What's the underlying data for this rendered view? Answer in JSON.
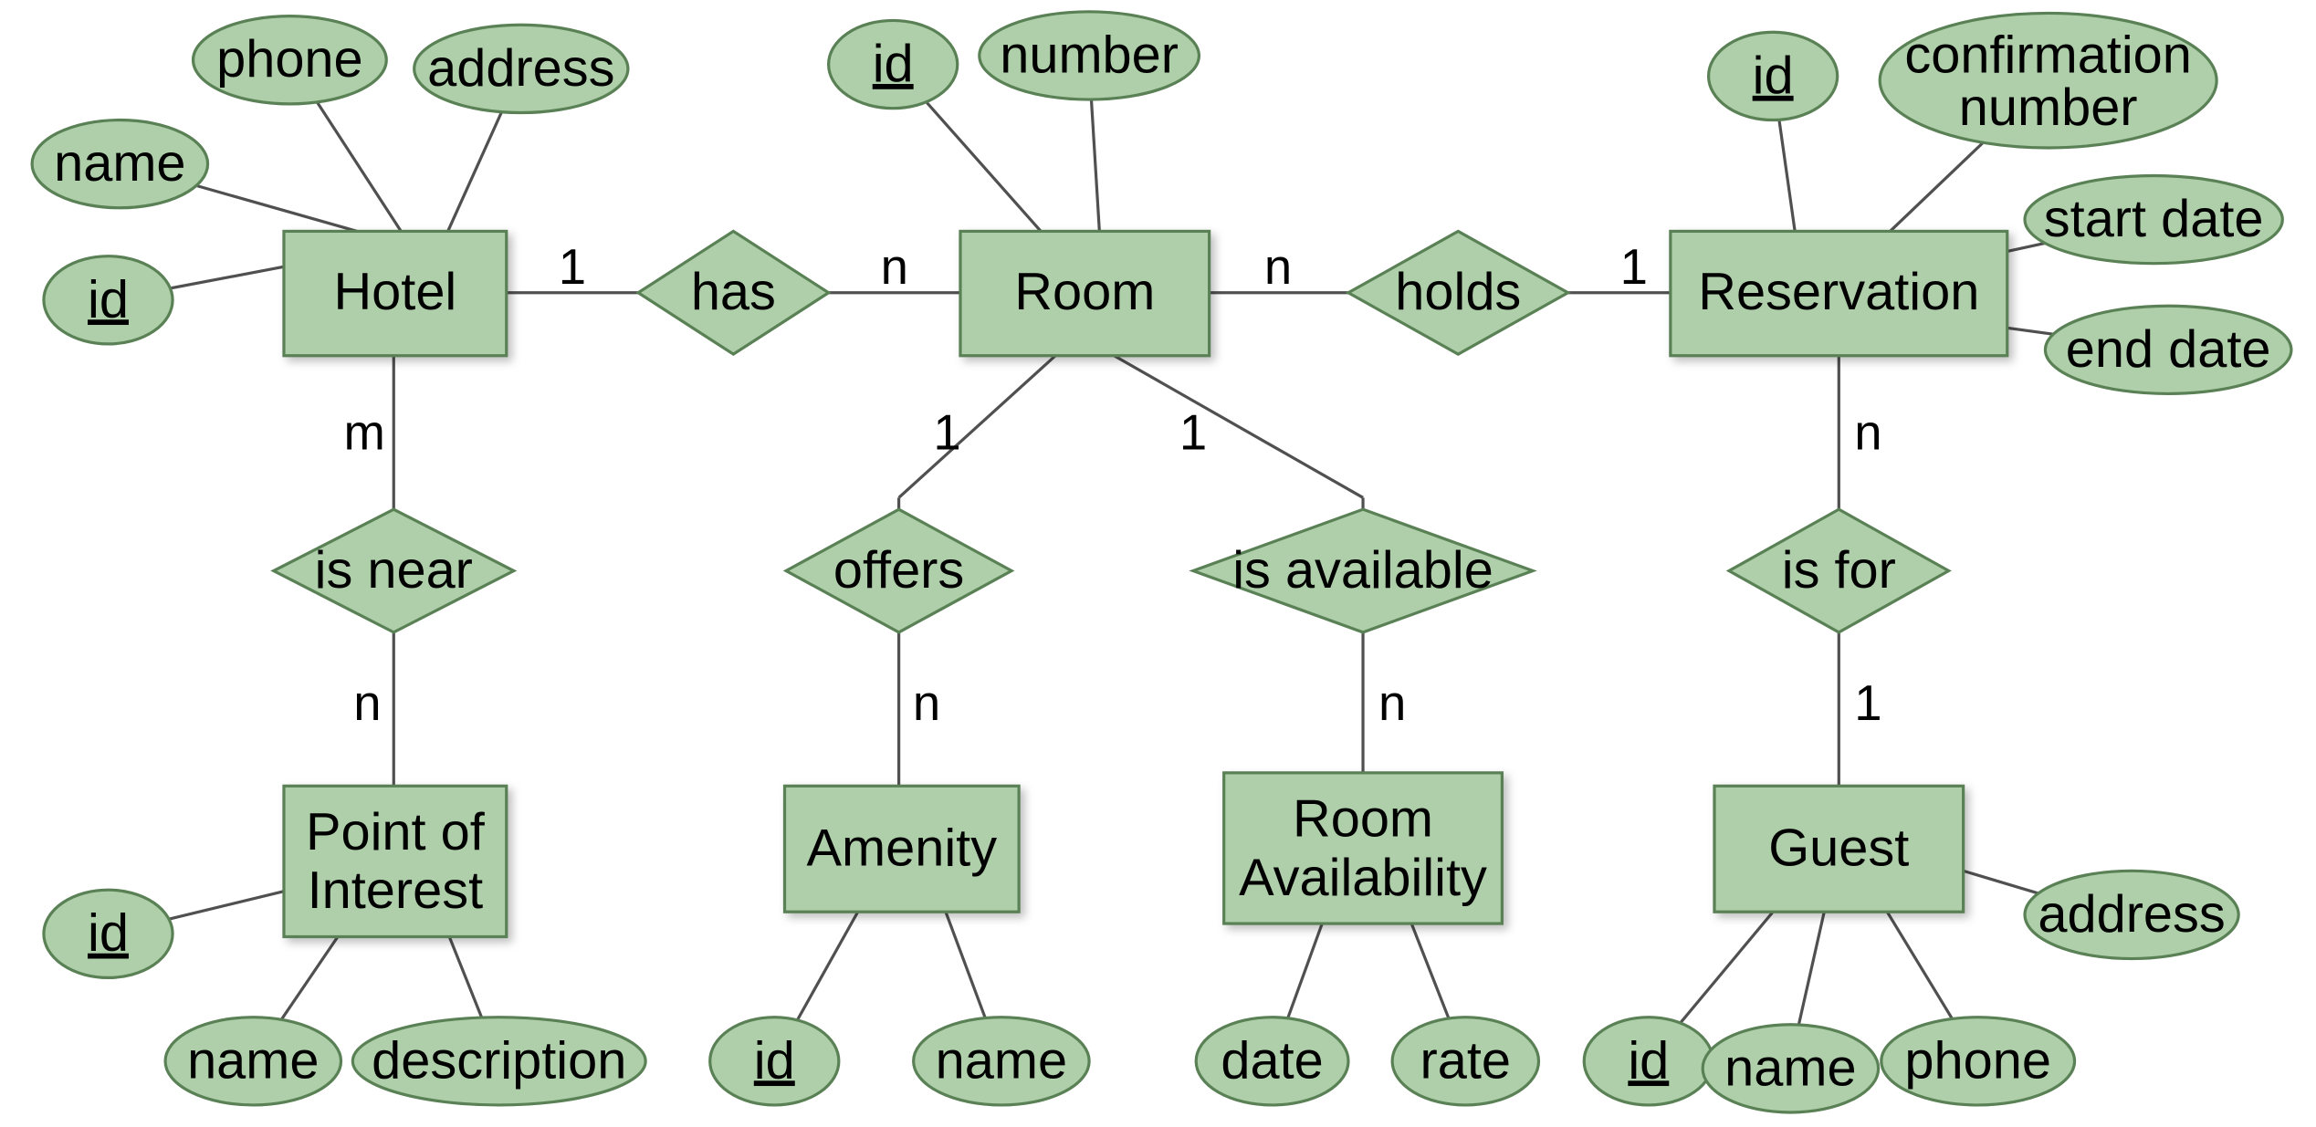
{
  "entities": {
    "hotel": {
      "label": "Hotel",
      "attrs": {
        "id": "id",
        "name": "name",
        "phone": "phone",
        "address": "address"
      }
    },
    "room": {
      "label": "Room",
      "attrs": {
        "id": "id",
        "number": "number"
      }
    },
    "reservation": {
      "label": "Reservation",
      "attrs": {
        "id": "id",
        "confirmation": "confirmation number",
        "start": "start date",
        "end": "end date"
      }
    },
    "poi": {
      "label": "Point of Interest",
      "line1": "Point of",
      "line2": "Interest",
      "attrs": {
        "id": "id",
        "name": "name",
        "description": "description"
      }
    },
    "amenity": {
      "label": "Amenity",
      "attrs": {
        "id": "id",
        "name": "name"
      }
    },
    "roomavail": {
      "label": "Room Availability",
      "line1": "Room",
      "line2": "Availability",
      "attrs": {
        "date": "date",
        "rate": "rate"
      }
    },
    "guest": {
      "label": "Guest",
      "attrs": {
        "id": "id",
        "name": "name",
        "phone": "phone",
        "address": "address"
      }
    }
  },
  "relationships": {
    "has": {
      "label": "has",
      "left_card": "1",
      "right_card": "n"
    },
    "holds": {
      "label": "holds",
      "left_card": "n",
      "right_card": "1"
    },
    "isnear": {
      "label": "is near",
      "top_card": "m",
      "bottom_card": "n"
    },
    "offers": {
      "label": "offers",
      "top_card": "1",
      "bottom_card": "n"
    },
    "isavail": {
      "label": "is available",
      "top_card": "1",
      "bottom_card": "n"
    },
    "isfor": {
      "label": "is for",
      "top_card": "n",
      "bottom_card": "1"
    }
  }
}
